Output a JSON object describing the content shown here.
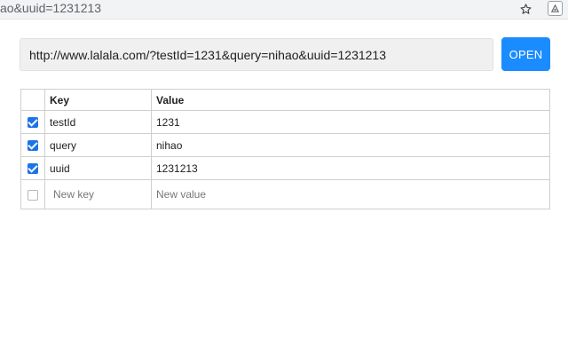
{
  "browser": {
    "url_tail": "ao&uuid=1231213"
  },
  "url_bar": {
    "value": "http://www.lalala.com/?testId=1231&query=nihao&uuid=1231213"
  },
  "open_button": {
    "label": "OPEN"
  },
  "table": {
    "headers": {
      "key": "Key",
      "value": "Value"
    },
    "rows": [
      {
        "checked": true,
        "key": "testId",
        "value": "1231"
      },
      {
        "checked": true,
        "key": "query",
        "value": "nihao"
      },
      {
        "checked": true,
        "key": "uuid",
        "value": "1231213"
      }
    ],
    "new_row": {
      "checked": false,
      "key_placeholder": "New key",
      "value_placeholder": "New value"
    }
  },
  "colors": {
    "accent": "#1b8cff",
    "checkbox": "#1b73e8"
  },
  "icons": {
    "bookmark": "star-icon",
    "extension": "extension-icon"
  }
}
